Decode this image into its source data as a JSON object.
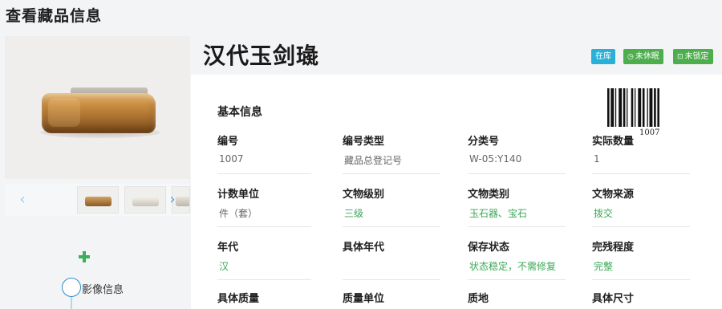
{
  "page": {
    "title": "查看藏品信息"
  },
  "media": {
    "main_photo": "jade-sword-slide-photo",
    "prev_icon": "‹",
    "next_icon": "›",
    "add_icon": "plus-icon",
    "timeline_label": "影像信息"
  },
  "item": {
    "name": "汉代玉剑璏",
    "badges": [
      {
        "label": "在库",
        "icon": "",
        "color": "#28b0d7"
      },
      {
        "label": "未休眠",
        "icon": "clock-icon",
        "color": "#4cae4c"
      },
      {
        "label": "未锁定",
        "icon": "lock-icon",
        "color": "#4cae4c"
      }
    ],
    "barcode_number": "1007"
  },
  "basic_info": {
    "title": "基本信息",
    "rows": [
      [
        {
          "label": "编号",
          "value": "1007"
        },
        {
          "label": "编号类型",
          "value": "藏品总登记号"
        },
        {
          "label": "分类号",
          "value": "W-05:Y140"
        },
        {
          "label": "实际数量",
          "value": "1"
        }
      ],
      [
        {
          "label": "计数单位",
          "value": "件（套）"
        },
        {
          "label": "文物级别",
          "value": "三级"
        },
        {
          "label": "文物类别",
          "value": "玉石器、宝石"
        },
        {
          "label": "文物来源",
          "value": "拨交"
        }
      ],
      [
        {
          "label": "年代",
          "value": "汉"
        },
        {
          "label": "具体年代",
          "value": ""
        },
        {
          "label": "保存状态",
          "value": "状态稳定，不需修复"
        },
        {
          "label": "完残程度",
          "value": "完整"
        }
      ],
      [
        {
          "label": "具体质量",
          "value": ""
        },
        {
          "label": "质量单位",
          "value": ""
        },
        {
          "label": "质地",
          "value": ""
        },
        {
          "label": "具体尺寸",
          "value": ""
        }
      ]
    ]
  }
}
